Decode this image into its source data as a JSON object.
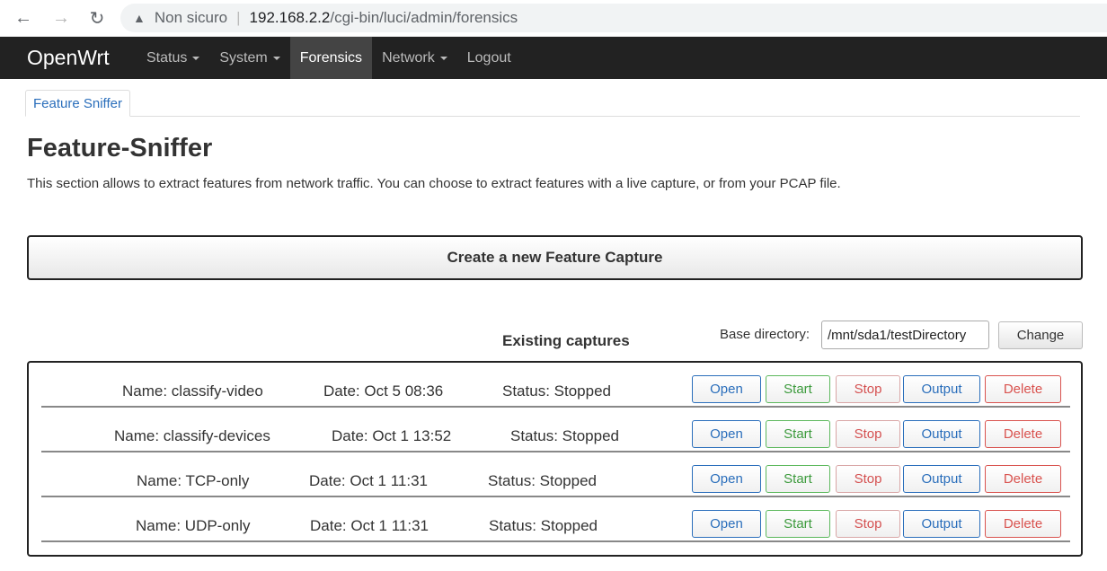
{
  "browser": {
    "insecure_label": "Non sicuro",
    "url_host": "192.168.2.2",
    "url_path": "/cgi-bin/luci/admin/forensics"
  },
  "header": {
    "brand": "OpenWrt",
    "menu": [
      {
        "label": "Status",
        "dropdown": true
      },
      {
        "label": "System",
        "dropdown": true
      },
      {
        "label": "Forensics",
        "dropdown": false,
        "active": true
      },
      {
        "label": "Network",
        "dropdown": true
      },
      {
        "label": "Logout",
        "dropdown": false
      }
    ]
  },
  "tabs": [
    {
      "label": "Feature Sniffer",
      "active": true
    }
  ],
  "page": {
    "title": "Feature-Sniffer",
    "description": "This section allows to extract features from network traffic. You can choose to extract features with a live capture, or from your PCAP file.",
    "create_button": "Create a new Feature Capture",
    "existing_heading": "Existing captures",
    "base_directory_label": "Base directory:",
    "base_directory_value": "/mnt/sda1/testDirectory",
    "change_button": "Change"
  },
  "buttons": {
    "open": "Open",
    "start": "Start",
    "stop": "Stop",
    "output": "Output",
    "delete": "Delete"
  },
  "captures": [
    {
      "name": "Name: classify-video",
      "date": "Date: Oct 5 08:36",
      "status": "Status: Stopped"
    },
    {
      "name": "Name: classify-devices",
      "date": "Date: Oct 1 13:52",
      "status": "Status: Stopped"
    },
    {
      "name": "Name: TCP-only",
      "date": "Date: Oct 1 11:31",
      "status": "Status: Stopped"
    },
    {
      "name": "Name: UDP-only",
      "date": "Date: Oct 1 11:31",
      "status": "Status: Stopped"
    }
  ]
}
